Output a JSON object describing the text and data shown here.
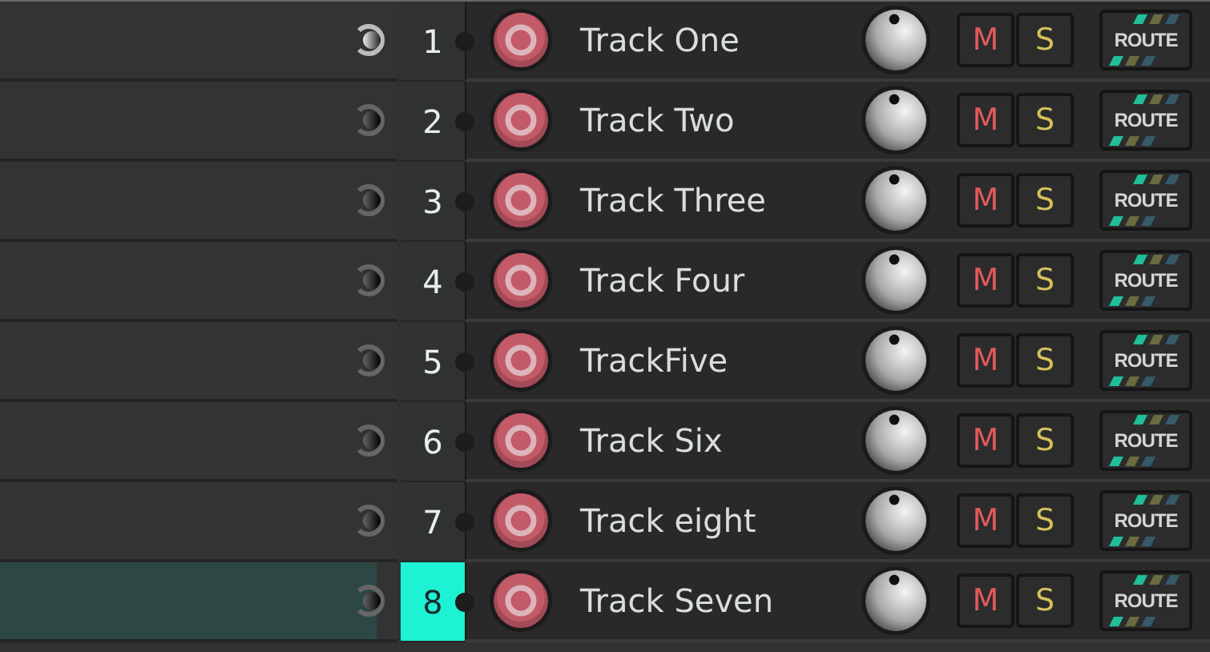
{
  "tracks": [
    {
      "number": "1",
      "name": "Track One",
      "selected": false,
      "monitor_on": true,
      "mute_label": "M",
      "solo_label": "S",
      "route_label": "ROUTE"
    },
    {
      "number": "2",
      "name": "Track Two",
      "selected": false,
      "monitor_on": false,
      "mute_label": "M",
      "solo_label": "S",
      "route_label": "ROUTE"
    },
    {
      "number": "3",
      "name": "Track Three",
      "selected": false,
      "monitor_on": false,
      "mute_label": "M",
      "solo_label": "S",
      "route_label": "ROUTE"
    },
    {
      "number": "4",
      "name": "Track Four",
      "selected": false,
      "monitor_on": false,
      "mute_label": "M",
      "solo_label": "S",
      "route_label": "ROUTE"
    },
    {
      "number": "5",
      "name": "TrackFive",
      "selected": false,
      "monitor_on": false,
      "mute_label": "M",
      "solo_label": "S",
      "route_label": "ROUTE"
    },
    {
      "number": "6",
      "name": "Track Six",
      "selected": false,
      "monitor_on": false,
      "mute_label": "M",
      "solo_label": "S",
      "route_label": "ROUTE"
    },
    {
      "number": "7",
      "name": "Track eight",
      "selected": false,
      "monitor_on": false,
      "mute_label": "M",
      "solo_label": "S",
      "route_label": "ROUTE"
    },
    {
      "number": "8",
      "name": "Track Seven",
      "selected": true,
      "monitor_on": false,
      "mute_label": "M",
      "solo_label": "S",
      "route_label": "ROUTE"
    }
  ]
}
